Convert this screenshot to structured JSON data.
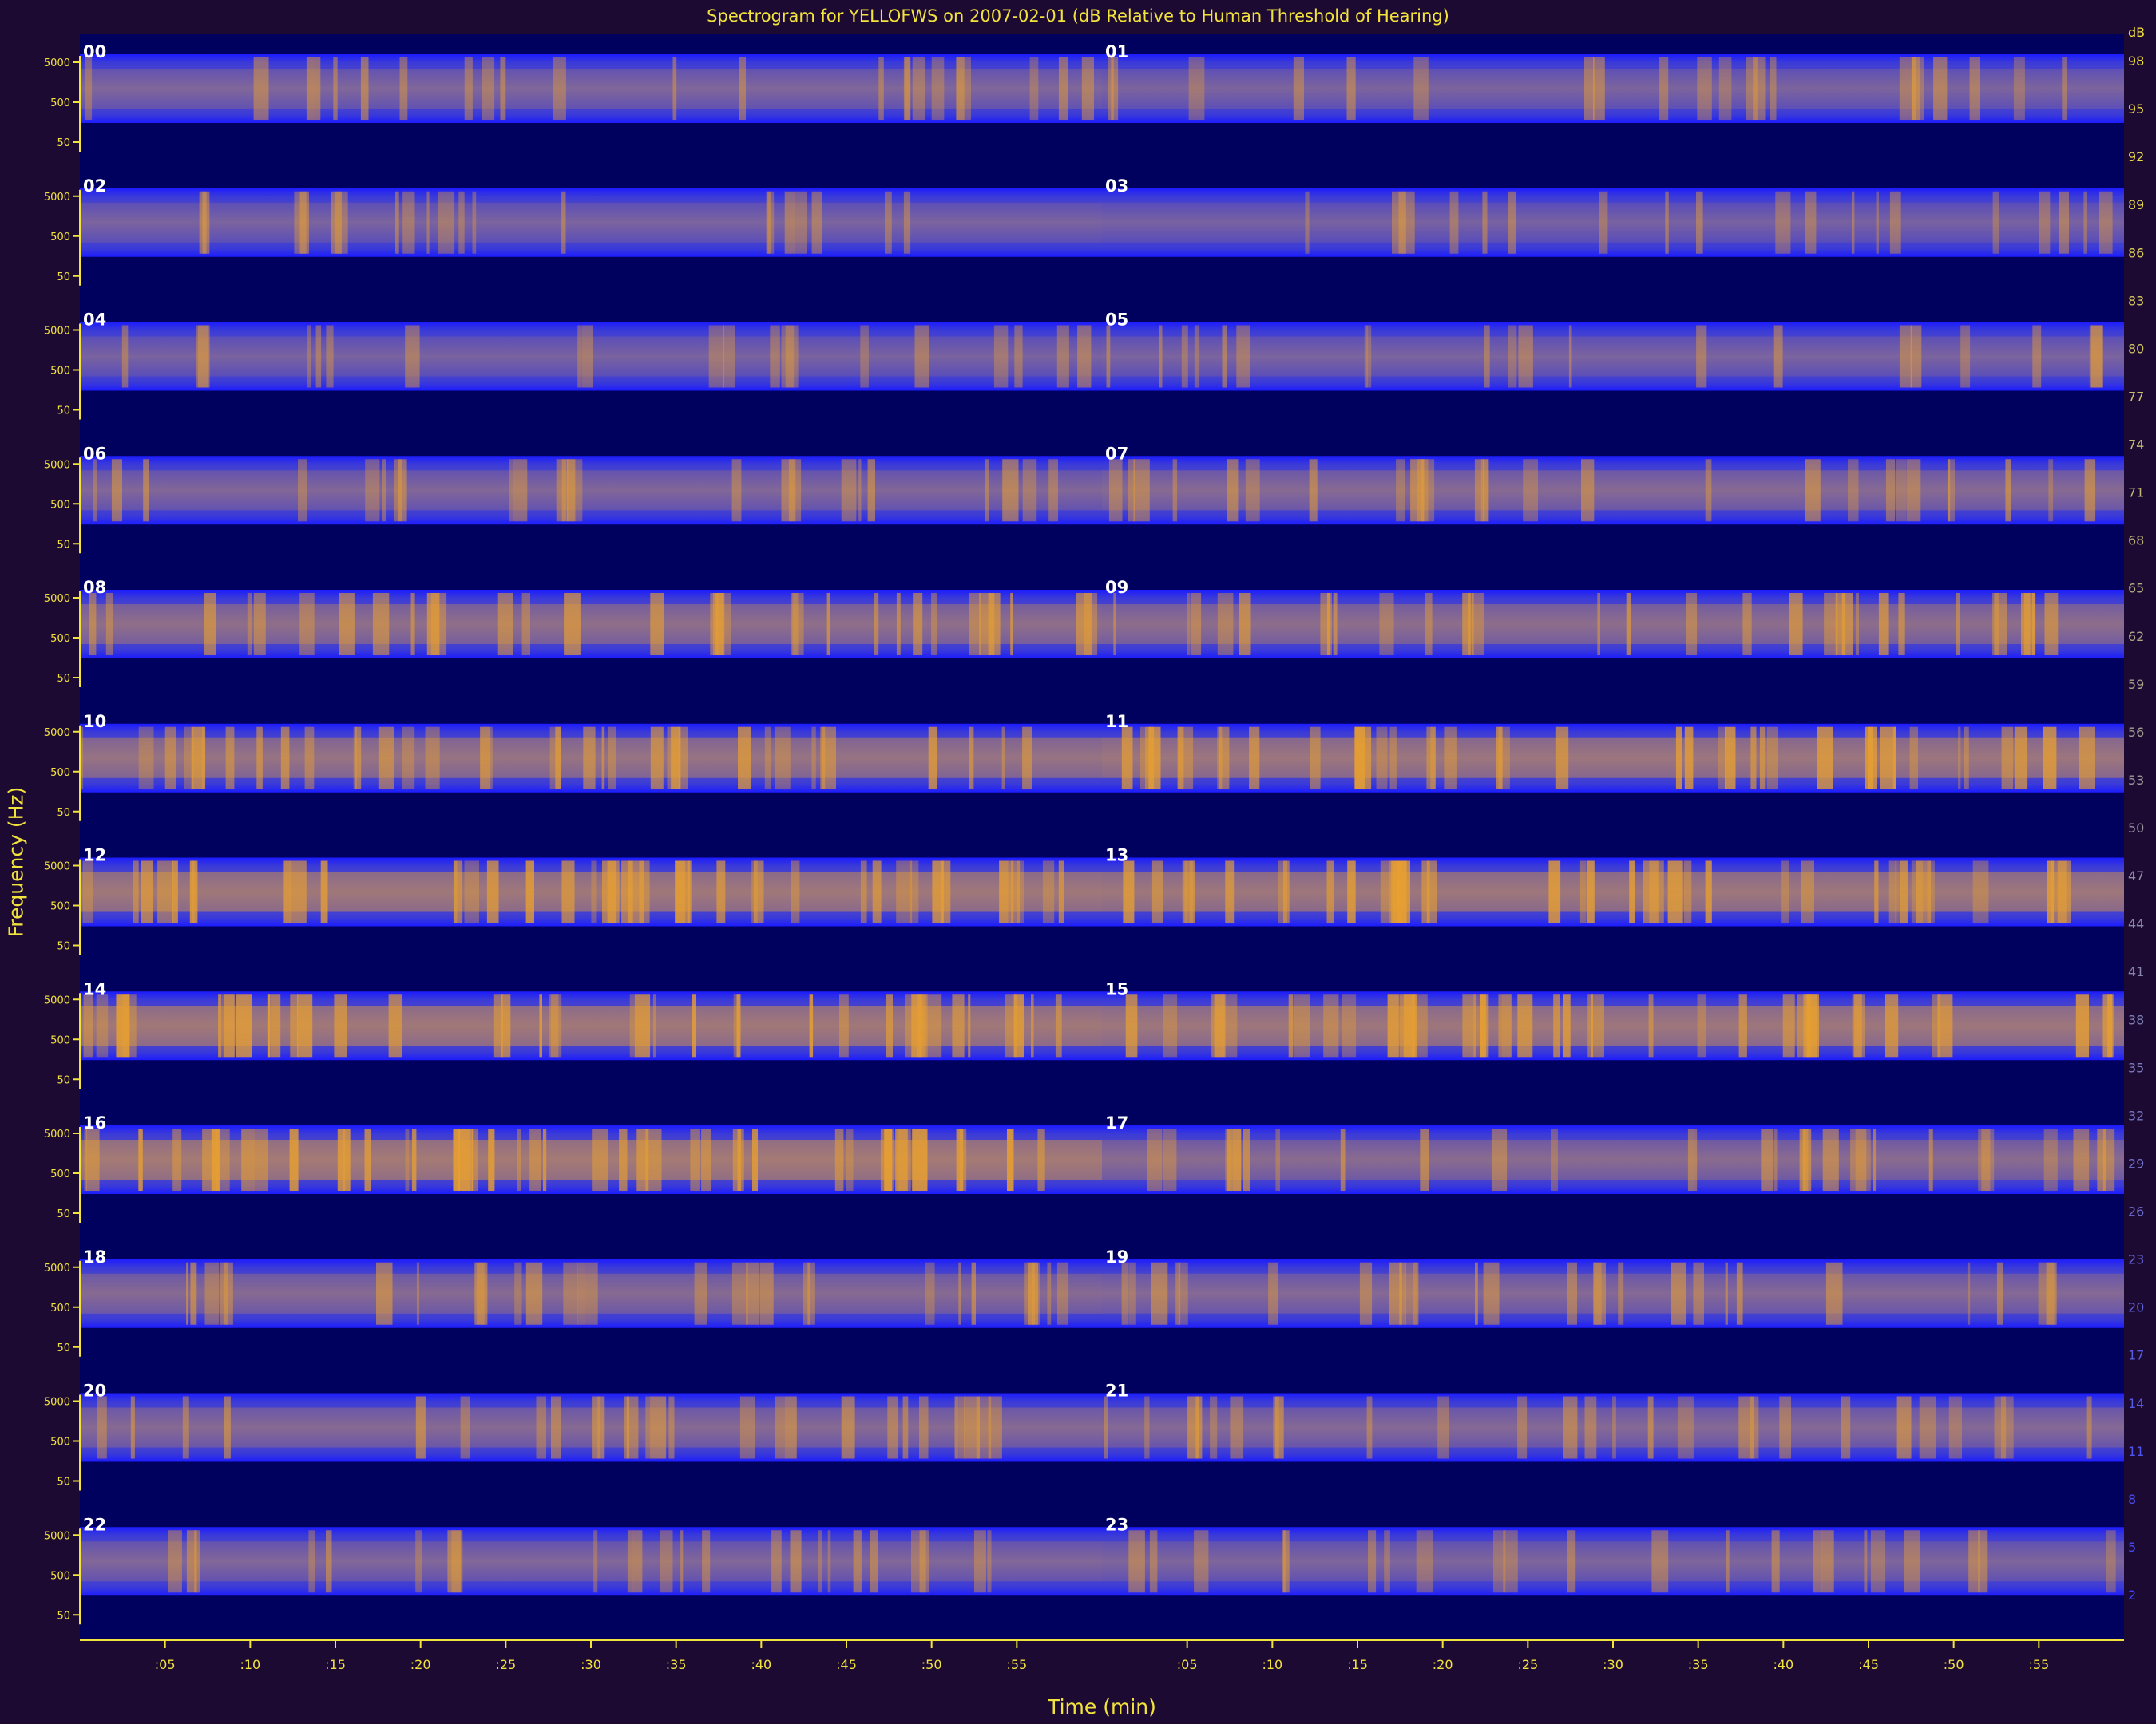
{
  "chart_data": {
    "type": "heatmap",
    "title": "Spectrogram for YELLOFWS on 2007-02-01 (dB Relative to Human Threshold of Hearing)",
    "xlabel": "Time (min)",
    "ylabel": "Frequency (Hz)",
    "x_tick_labels": [
      ":05",
      ":10",
      ":15",
      ":20",
      ":25",
      ":30",
      ":35",
      ":40",
      ":45",
      ":50",
      ":55"
    ],
    "y_tick_labels": [
      "5000",
      "500",
      "50"
    ],
    "hour_labels": [
      "00",
      "01",
      "02",
      "03",
      "04",
      "05",
      "06",
      "07",
      "08",
      "09",
      "10",
      "11",
      "12",
      "13",
      "14",
      "15",
      "16",
      "17",
      "18",
      "19",
      "20",
      "21",
      "22",
      "23"
    ],
    "colorbar": {
      "unit": "dB",
      "tick_values": [
        98,
        95,
        92,
        89,
        86,
        83,
        80,
        77,
        74,
        71,
        68,
        65,
        62,
        59,
        56,
        53,
        50,
        47,
        44,
        41,
        38,
        35,
        32,
        29,
        26,
        23,
        20,
        17,
        14,
        11,
        8,
        5,
        2
      ],
      "low_color": "#13137a",
      "mid_color": "#1c1cff",
      "high_color": "#e8a030"
    },
    "hour_activity": [
      0.32,
      0.28,
      0.25,
      0.22,
      0.24,
      0.26,
      0.35,
      0.42,
      0.55,
      0.52,
      0.65,
      0.72,
      0.78,
      0.76,
      0.8,
      0.74,
      0.86,
      0.48,
      0.44,
      0.4,
      0.42,
      0.4,
      0.34,
      0.3
    ]
  },
  "colors": {
    "background": "#1d0a33",
    "axis": "#f2e23c",
    "plot_bg": "#00005e",
    "hour_label": "#ffffff"
  }
}
